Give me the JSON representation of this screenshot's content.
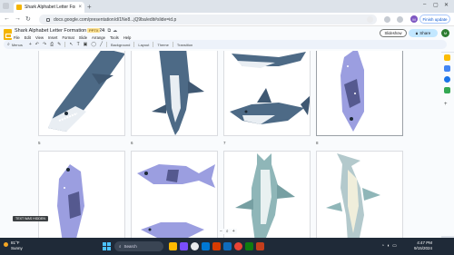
{
  "browser": {
    "tab_title": "Shark Alphabet Letter Formatio",
    "url": "docs.google.com/presentation/d/1Ne8...jQ9ba/edit#slide=id.p",
    "finish_update_label": "Finish update",
    "profile_initial": "M"
  },
  "slides_app": {
    "doc_title": "Shark Alphabet Letter Formation 9.15.24",
    "file_badge": "PPTX",
    "menu": [
      "File",
      "Edit",
      "View",
      "Insert",
      "Format",
      "Slide",
      "Arrange",
      "Tools",
      "Help"
    ],
    "slideshow_label": "Slideshow",
    "share_label": "Share",
    "user_initial": "M"
  },
  "toolbar": {
    "search_label": "Menus",
    "background_label": "Background",
    "layout_label": "Layout",
    "theme_label": "Theme",
    "transition_label": "Transition"
  },
  "grid": {
    "slide_numbers": [
      "5",
      "6",
      "7",
      "8"
    ],
    "caption": "TEXT WAS HIDDEN"
  },
  "taskbar": {
    "weather_temp": "81°F",
    "weather_desc": "Sunny",
    "search_placeholder": "Search",
    "time": "4:47 PM",
    "date": "9/15/2024"
  },
  "colors": {
    "shark_blue": "#4d6a86",
    "shark_belly": "#e9eef3",
    "fish_purple": "#9b9ee0",
    "hammerhead": "#8fb6b8",
    "accent": "#0b57d0"
  }
}
